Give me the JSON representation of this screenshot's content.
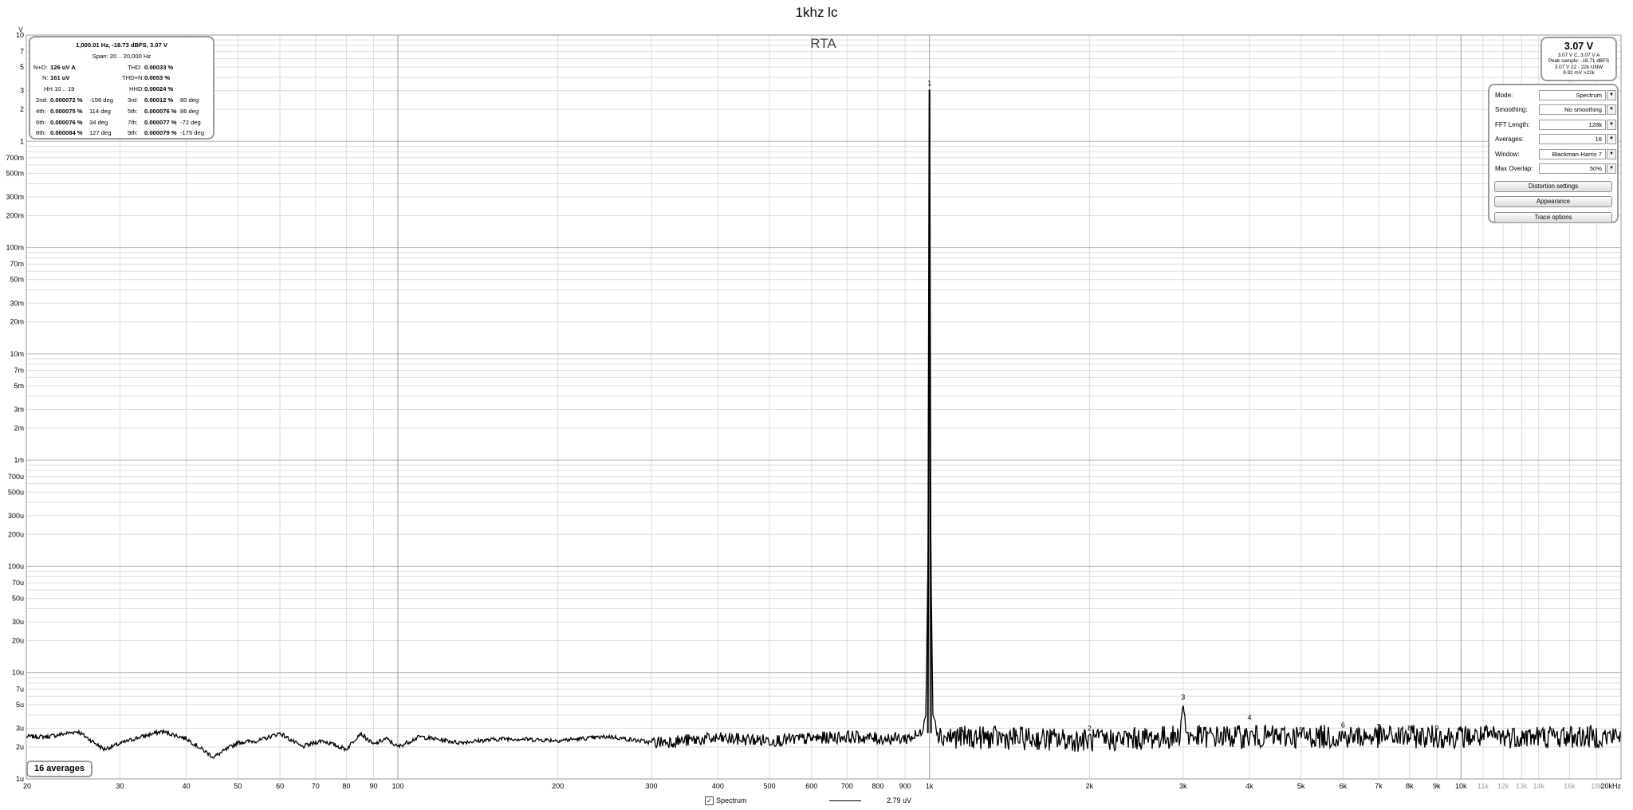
{
  "title": "1khz lc",
  "rta_label": "RTA",
  "stats": {
    "header": "1,000.01 Hz, -18.73 dBFS, 3.07 V",
    "span": "Span: 20 .. 20,000 Hz",
    "n_d_label": "N+D:",
    "n_d_value": "126 uV A",
    "thd_label": "THD:",
    "thd_value": "0.00033 %",
    "n_label": "N:",
    "n_value": "161 uV",
    "thd_n_label": "THD+N:",
    "thd_n_value": "0.0053 %",
    "hh_label": "HH 10 .. 19",
    "hhd_label": "HHD:",
    "hhd_value": "0.00024 %",
    "harmonics": [
      [
        {
          "label": "2nd:",
          "pct": "0.000072 %",
          "deg": "-156 deg"
        },
        {
          "label": "3rd:",
          "pct": "0.00012 %",
          "deg": "80 deg"
        }
      ],
      [
        {
          "label": "4th:",
          "pct": "0.000075 %",
          "deg": "114 deg"
        },
        {
          "label": "5th:",
          "pct": "0.000076 %",
          "deg": "86 deg"
        }
      ],
      [
        {
          "label": "6th:",
          "pct": "0.000076 %",
          "deg": "34 deg"
        },
        {
          "label": "7th:",
          "pct": "0.000077 %",
          "deg": "-72 deg"
        }
      ],
      [
        {
          "label": "8th:",
          "pct": "0.000084 %",
          "deg": "127 deg"
        },
        {
          "label": "9th:",
          "pct": "0.000079 %",
          "deg": "-175 deg"
        }
      ]
    ]
  },
  "level": {
    "main": "3.07 V",
    "line1": "3.07 V C, 3.07 V A",
    "line2": "Peak sample: -18.71 dBFS",
    "line3": "3.07 V 22 - 22k UNW",
    "line4": "9.92 mV >22k"
  },
  "controls": {
    "rows": [
      {
        "label": "Mode:",
        "value": "Spectrum"
      },
      {
        "label": "Smoothing:",
        "value": "No smoothing"
      },
      {
        "label": "FFT Length:",
        "value": "128k"
      },
      {
        "label": "Averages:",
        "value": "16"
      },
      {
        "label": "Window:",
        "value": "Blackman-Harris 7"
      },
      {
        "label": "Max Overlap:",
        "value": "50%"
      }
    ],
    "buttons": {
      "distortion": "Distortion settings",
      "appearance": "Appearance",
      "trace": "Trace options"
    }
  },
  "averages_badge": "16 averages",
  "legend": {
    "spectrum_label": "Spectrum",
    "checked": true,
    "value": "2.79 uV"
  },
  "colors": {
    "trace": "#000000",
    "grid_major": "#b4b4b4",
    "grid_minor": "#dcdcdc",
    "faded_tick": "#a0a0a0"
  },
  "chart_data": {
    "type": "line",
    "x_scale": "log",
    "y_scale": "log",
    "xlim": [
      20,
      20000
    ],
    "ylim_volts": [
      1e-06,
      10
    ],
    "y_axis_unit_label": "V",
    "x_unit_suffix": "Hz",
    "x_ticks": [
      {
        "v": 20,
        "t": "20"
      },
      {
        "v": 30,
        "t": "30"
      },
      {
        "v": 40,
        "t": "40"
      },
      {
        "v": 50,
        "t": "50"
      },
      {
        "v": 60,
        "t": "60"
      },
      {
        "v": 70,
        "t": "70"
      },
      {
        "v": 80,
        "t": "80"
      },
      {
        "v": 90,
        "t": "90"
      },
      {
        "v": 100,
        "t": "100"
      },
      {
        "v": 200,
        "t": "200"
      },
      {
        "v": 300,
        "t": "300"
      },
      {
        "v": 400,
        "t": "400"
      },
      {
        "v": 500,
        "t": "500"
      },
      {
        "v": 600,
        "t": "600"
      },
      {
        "v": 700,
        "t": "700"
      },
      {
        "v": 800,
        "t": "800"
      },
      {
        "v": 900,
        "t": "900"
      },
      {
        "v": 1000,
        "t": "1k"
      },
      {
        "v": 2000,
        "t": "2k"
      },
      {
        "v": 3000,
        "t": "3k"
      },
      {
        "v": 4000,
        "t": "4k"
      },
      {
        "v": 5000,
        "t": "5k"
      },
      {
        "v": 6000,
        "t": "6k"
      },
      {
        "v": 7000,
        "t": "7k"
      },
      {
        "v": 8000,
        "t": "8k"
      },
      {
        "v": 9000,
        "t": "9k"
      },
      {
        "v": 10000,
        "t": "10k"
      },
      {
        "v": 11000,
        "t": "11k",
        "faded": true
      },
      {
        "v": 12000,
        "t": "12k",
        "faded": true
      },
      {
        "v": 13000,
        "t": "13k",
        "faded": true
      },
      {
        "v": 14000,
        "t": "14k",
        "faded": true
      },
      {
        "v": 16000,
        "t": "16k",
        "faded": true
      },
      {
        "v": 18000,
        "t": "18k",
        "faded": true
      },
      {
        "v": 20000,
        "t": "20kHz"
      }
    ],
    "y_ticks": [
      {
        "v": 10,
        "t": "10"
      },
      {
        "v": 7,
        "t": "7"
      },
      {
        "v": 5,
        "t": "5"
      },
      {
        "v": 3,
        "t": "3"
      },
      {
        "v": 2,
        "t": "2"
      },
      {
        "v": 1,
        "t": "1"
      },
      {
        "v": 0.7,
        "t": "700m"
      },
      {
        "v": 0.5,
        "t": "500m"
      },
      {
        "v": 0.3,
        "t": "300m"
      },
      {
        "v": 0.2,
        "t": "200m"
      },
      {
        "v": 0.1,
        "t": "100m"
      },
      {
        "v": 0.07,
        "t": "70m"
      },
      {
        "v": 0.05,
        "t": "50m"
      },
      {
        "v": 0.03,
        "t": "30m"
      },
      {
        "v": 0.02,
        "t": "20m"
      },
      {
        "v": 0.01,
        "t": "10m"
      },
      {
        "v": 0.007,
        "t": "7m"
      },
      {
        "v": 0.005,
        "t": "5m"
      },
      {
        "v": 0.003,
        "t": "3m"
      },
      {
        "v": 0.002,
        "t": "2m"
      },
      {
        "v": 0.001,
        "t": "1m"
      },
      {
        "v": 0.0007,
        "t": "700u"
      },
      {
        "v": 0.0005,
        "t": "500u"
      },
      {
        "v": 0.0003,
        "t": "300u"
      },
      {
        "v": 0.0002,
        "t": "200u"
      },
      {
        "v": 0.0001,
        "t": "100u"
      },
      {
        "v": 7e-05,
        "t": "70u"
      },
      {
        "v": 5e-05,
        "t": "50u"
      },
      {
        "v": 3e-05,
        "t": "30u"
      },
      {
        "v": 2e-05,
        "t": "20u"
      },
      {
        "v": 1e-05,
        "t": "10u"
      },
      {
        "v": 7e-06,
        "t": "7u"
      },
      {
        "v": 5e-06,
        "t": "5u"
      },
      {
        "v": 3e-06,
        "t": "3u"
      },
      {
        "v": 2e-06,
        "t": "2u"
      },
      {
        "v": 1e-06,
        "t": "1u"
      }
    ],
    "series": [
      {
        "points": [
          [
            20,
            2.5e-06
          ],
          [
            22,
            2.5e-06
          ],
          [
            25,
            2.8e-06
          ],
          [
            28,
            1.9e-06
          ],
          [
            32,
            2.4e-06
          ],
          [
            36,
            2.8e-06
          ],
          [
            40,
            2.4e-06
          ],
          [
            45,
            1.6e-06
          ],
          [
            50,
            2.2e-06
          ],
          [
            55,
            2.3e-06
          ],
          [
            60,
            2.7e-06
          ],
          [
            66,
            2e-06
          ],
          [
            72,
            2.3e-06
          ],
          [
            80,
            1.9e-06
          ],
          [
            85,
            2.7e-06
          ],
          [
            90,
            2.1e-06
          ],
          [
            95,
            2.4e-06
          ],
          [
            100,
            2e-06
          ],
          [
            110,
            2.5e-06
          ],
          [
            130,
            2.2e-06
          ],
          [
            160,
            2.4e-06
          ],
          [
            200,
            2.3e-06
          ],
          [
            250,
            2.5e-06
          ],
          [
            300,
            2.2e-06
          ],
          [
            400,
            2.4e-06
          ],
          [
            500,
            2.3e-06
          ],
          [
            600,
            2.4e-06
          ],
          [
            700,
            2.5e-06
          ],
          [
            800,
            2.4e-06
          ],
          [
            900,
            2.4e-06
          ],
          [
            960,
            2.6e-06
          ],
          [
            985,
            4e-06
          ],
          [
            995,
            0.0002
          ],
          [
            1000,
            3.07
          ],
          [
            1005,
            0.0002
          ],
          [
            1015,
            4e-06
          ],
          [
            1050,
            2.5e-06
          ],
          [
            1500,
            2.4e-06
          ],
          [
            2000,
            2.3e-06
          ],
          [
            2500,
            2.4e-06
          ],
          [
            2950,
            2.5e-06
          ],
          [
            3000,
            5.1e-06
          ],
          [
            3050,
            2.5e-06
          ],
          [
            4000,
            2.5e-06
          ],
          [
            6000,
            2.5e-06
          ],
          [
            10000,
            2.5e-06
          ],
          [
            15000,
            2.5e-06
          ],
          [
            20000,
            2.5e-06
          ]
        ]
      }
    ],
    "peak_markers": [
      {
        "label": "1",
        "f": 1000,
        "v": 3.07
      },
      {
        "label": "2",
        "f": 2000,
        "v": 2.6e-06
      },
      {
        "label": "3",
        "f": 3000,
        "v": 5.1e-06
      },
      {
        "label": "4",
        "f": 4000,
        "v": 3.3e-06
      },
      {
        "label": "5",
        "f": 5000,
        "v": 2.5e-06
      },
      {
        "label": "6",
        "f": 6000,
        "v": 2.8e-06
      },
      {
        "label": "7",
        "f": 7000,
        "v": 2.7e-06
      },
      {
        "label": "8",
        "f": 8000,
        "v": 2.6e-06
      },
      {
        "label": "9",
        "f": 9000,
        "v": 2.6e-06
      }
    ]
  }
}
